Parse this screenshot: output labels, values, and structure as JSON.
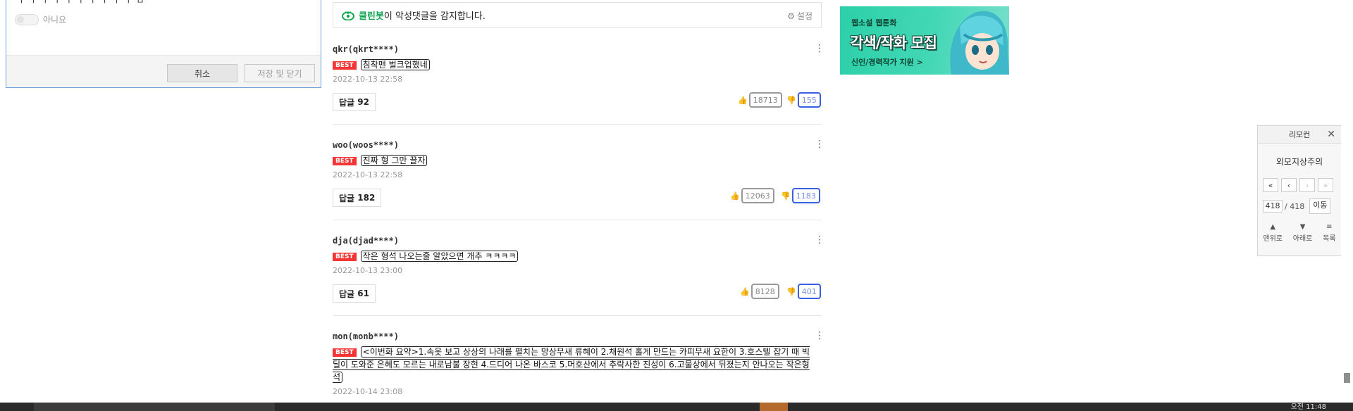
{
  "dialog": {
    "cut_text": "ㅜ ㅜ ㅜ ㅜ ㅜ ㅜ ㅜ ㅜ ㅜ ㅜ ㅁ",
    "toggle_label": "아니요",
    "cancel_label": "취소",
    "save_label": "저장 및 닫기"
  },
  "cleanbot": {
    "brand": "클린봇",
    "message": "이 악성댓글을 감지합니다.",
    "settings_label": "설정"
  },
  "comments": [
    {
      "author": "qkr(qkrt****)",
      "best": "BEST",
      "text": "침착맨 벌크업했네",
      "date": "2022-10-13 22:58",
      "reply_label": "답글",
      "reply_count": "92",
      "likes": "18713",
      "dislikes": "155"
    },
    {
      "author": "woo(woos****)",
      "best": "BEST",
      "text": "진짜 형 그만 끌자",
      "date": "2022-10-13 22:58",
      "reply_label": "답글",
      "reply_count": "182",
      "likes": "12063",
      "dislikes": "1183"
    },
    {
      "author": "dja(djad****)",
      "best": "BEST",
      "text": "작은 형석 나오는줄 알았으면 개추 ㅋㅋㅋㅋ",
      "date": "2022-10-13 23:00",
      "reply_label": "답글",
      "reply_count": "61",
      "likes": "8128",
      "dislikes": "401"
    },
    {
      "author": "mon(monb****)",
      "best": "BEST",
      "text": "<이번화 요약>1.속옷 보고 상상의 나래를 펼치는 망상무새 류혜이 2.채원석 홀게 만드는 카피무새 요한이 3.호스텔 잡기 때 빅딜이 도와준 은혜도 모르는 내로남불 장현 4.드디어 나온 바스코 5.머호산에서 추락사한 진성이 6.고물상에서 뒤졌는지 안나오는 작은형석",
      "date": "2022-10-14 23:08"
    }
  ],
  "ad": {
    "small_text": "웹소설 웹툰화",
    "big_text": "각색/작화 모집",
    "sub_text": "신인/경력작가 지원 >"
  },
  "remote": {
    "header": "리모컨",
    "title": "외모지상주의",
    "nav_first": "«",
    "nav_prev": "‹",
    "nav_next": "›",
    "nav_last": "»",
    "current_page": "418",
    "total_pages": "/ 418",
    "go_label": "이동",
    "top_label": "맨위로",
    "bottom_label": "아래로",
    "list_label": "목록"
  },
  "taskbar": {
    "clock": "오전 11:48"
  },
  "colors": {
    "accent_green": "#12a553",
    "best_red": "#f53535",
    "dislike_blue": "#3a5fe6"
  }
}
